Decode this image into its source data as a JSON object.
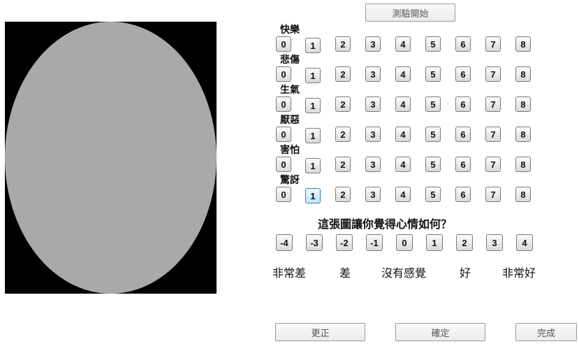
{
  "start_button": "測驗開始",
  "emotions": [
    {
      "label": "快樂",
      "selected": null
    },
    {
      "label": "悲傷",
      "selected": null
    },
    {
      "label": "生氣",
      "selected": null
    },
    {
      "label": "厭惡",
      "selected": null
    },
    {
      "label": "害怕",
      "selected": null
    },
    {
      "label": "驚訝",
      "selected": "1"
    }
  ],
  "intensity_options": [
    "0",
    "1",
    "2",
    "3",
    "4",
    "5",
    "6",
    "7",
    "8"
  ],
  "question": "這張圖讓你覺得心情如何？",
  "valence_options": [
    "-4",
    "-3",
    "-2",
    "-1",
    "0",
    "1",
    "2",
    "3",
    "4"
  ],
  "scale_labels": [
    "非常差",
    "差",
    "沒有感覺",
    "好",
    "非常好"
  ],
  "bottom_buttons": {
    "correct": "更正",
    "confirm": "確定",
    "finish": "完成"
  },
  "colors": {
    "stimulus_background": "#000000",
    "stimulus_oval": "#a9a9a9",
    "selected_button": "#bee6fd"
  }
}
